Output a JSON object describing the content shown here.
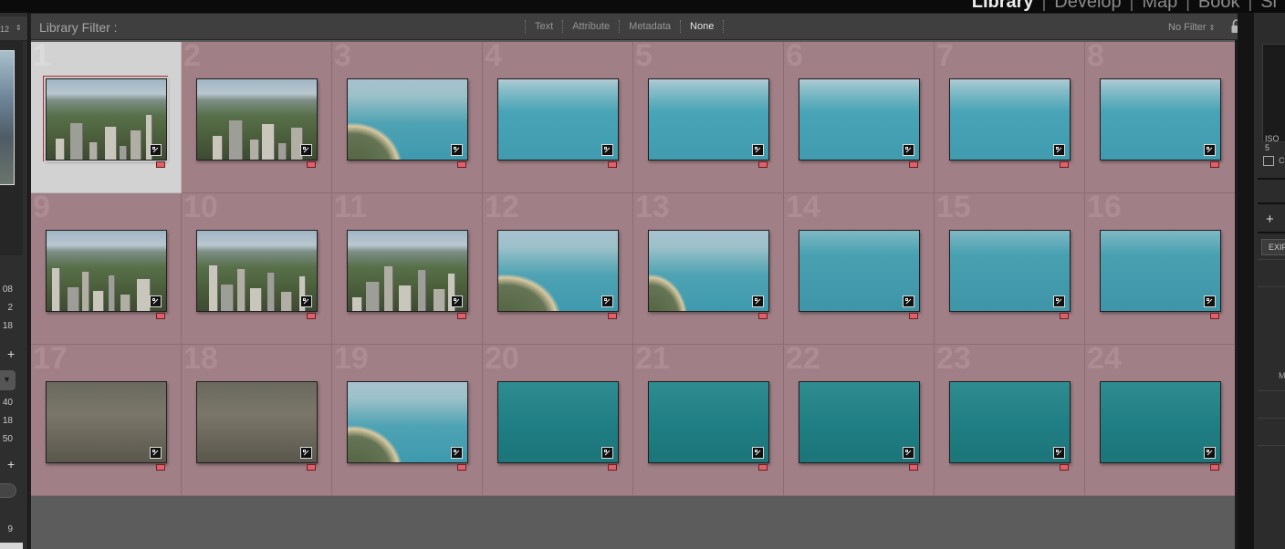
{
  "modules": {
    "items": [
      "Library",
      "Develop",
      "Map",
      "Book",
      "Sl"
    ],
    "active": "Library"
  },
  "left_panel": {
    "top_value": "12",
    "numbers_a": [
      "08",
      "2",
      "18"
    ],
    "numbers_b": [
      "40",
      "18",
      "50"
    ],
    "number_c": "9",
    "plus_label": "+"
  },
  "filter_bar": {
    "title": "Library Filter :",
    "tabs": [
      "Text",
      "Attribute",
      "Metadata",
      "None"
    ],
    "active_tab": "None",
    "preset": "No Filter"
  },
  "grid": {
    "selected": 1,
    "cells": [
      {
        "num": "1",
        "style": "city"
      },
      {
        "num": "2",
        "style": "city"
      },
      {
        "num": "3",
        "style": "coast"
      },
      {
        "num": "4",
        "style": "sea"
      },
      {
        "num": "5",
        "style": "sea"
      },
      {
        "num": "6",
        "style": "sea"
      },
      {
        "num": "7",
        "style": "sea"
      },
      {
        "num": "8",
        "style": "sea"
      },
      {
        "num": "9",
        "style": "city"
      },
      {
        "num": "10",
        "style": "city"
      },
      {
        "num": "11",
        "style": "city"
      },
      {
        "num": "12",
        "style": "coast"
      },
      {
        "num": "13",
        "style": "coast"
      },
      {
        "num": "14",
        "style": "sea2"
      },
      {
        "num": "15",
        "style": "sea2"
      },
      {
        "num": "16",
        "style": "sea2"
      },
      {
        "num": "17",
        "style": "dense"
      },
      {
        "num": "18",
        "style": "dense"
      },
      {
        "num": "19",
        "style": "coast"
      },
      {
        "num": "20",
        "style": "deep"
      },
      {
        "num": "21",
        "style": "deep"
      },
      {
        "num": "22",
        "style": "deep"
      },
      {
        "num": "23",
        "style": "deep"
      },
      {
        "num": "24",
        "style": "deep"
      }
    ],
    "label_color": "#e0606a",
    "cell_color": "#a07f86"
  },
  "right_panel": {
    "iso_label": "ISO 5",
    "check_label": "C",
    "plus_label": "+",
    "exif_label": "EXIF",
    "m_label": "M"
  },
  "icons": {
    "lock": "lock-icon",
    "badge": "develop-adjusted-icon",
    "label": "color-label-icon"
  }
}
